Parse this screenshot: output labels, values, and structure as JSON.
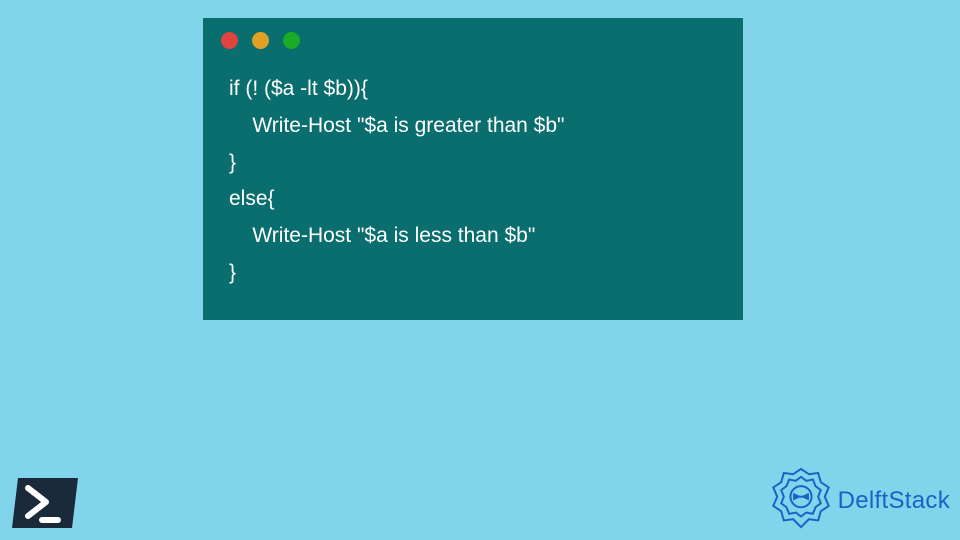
{
  "code": {
    "lines": [
      "if (! ($a -lt $b)){",
      "    Write-Host \"$a is greater than $b\"",
      "}",
      "else{",
      "    Write-Host \"$a is less than $b\"",
      "}"
    ]
  },
  "window": {
    "dots": [
      "red",
      "yellow",
      "green"
    ]
  },
  "brand": {
    "name": "DelftStack"
  },
  "icons": {
    "powershell": "powershell-icon",
    "brand_logo": "delftstack-logo"
  },
  "colors": {
    "background": "#81d4ea",
    "window_bg": "#0b6e6e",
    "code_text": "#ffffff",
    "brand": "#1863c7"
  }
}
